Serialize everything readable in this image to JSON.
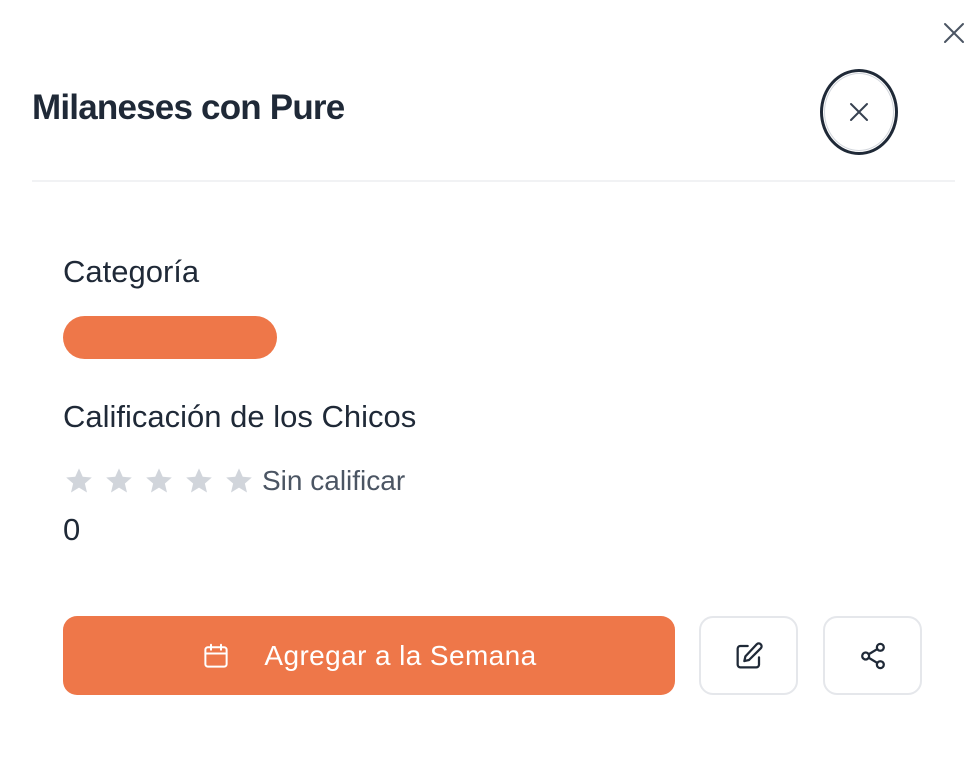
{
  "recipe": {
    "title": "Milaneses con Pure"
  },
  "category": {
    "label": "Categoría",
    "color": "#ee7749"
  },
  "rating": {
    "label": "Calificación de los Chicos",
    "stars_total": 5,
    "stars_filled": 0,
    "status_text": "Sin calificar",
    "count": "0",
    "star_color_empty": "#d1d5db"
  },
  "actions": {
    "add_to_week_label": "Agregar a la Semana",
    "add_to_week_icon": "calendar-icon",
    "edit_icon": "edit-icon",
    "share_icon": "share-icon"
  },
  "colors": {
    "accent": "#ee7749",
    "text": "#1f2937"
  }
}
